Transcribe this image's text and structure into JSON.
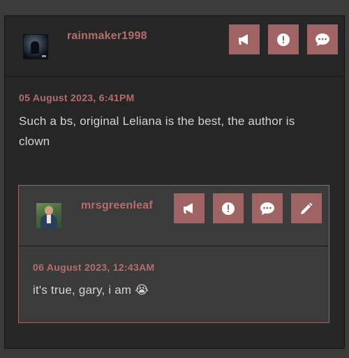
{
  "post": {
    "username": "rainmaker1998",
    "date": "05 August 2023, 6:41PM",
    "text": "Such a bs, original Leliana is the best, the author is clown",
    "actions": [
      "megaphone-icon",
      "report-icon",
      "reply-icon"
    ]
  },
  "reply": {
    "username": "mrsgreenleaf",
    "date": "06 August 2023, 12:43AM",
    "text": "it's true, gary, i am 😭",
    "actions": [
      "megaphone-icon",
      "report-icon",
      "reply-icon",
      "edit-icon"
    ]
  },
  "colors": {
    "accent": "#a06464",
    "username": "#b66d6d",
    "text": "#d4d4d4",
    "panel": "#262626",
    "reply_panel": "#3b3b3b"
  }
}
